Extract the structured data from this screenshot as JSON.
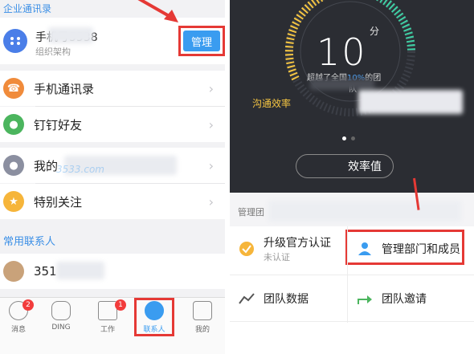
{
  "left": {
    "section_enterprise": "企业通讯录",
    "org": {
      "name": "手机号5538",
      "subtitle": "组织架构"
    },
    "manage_button": "管理",
    "rows": [
      {
        "label": "手机通讯录",
        "icon": "phone-contacts-icon",
        "color": "#f08b3b"
      },
      {
        "label": "钉钉好友",
        "icon": "friend-icon",
        "color": "#4bb55e"
      },
      {
        "label": "我的",
        "icon": "my-icon",
        "color": "#8b8fa0"
      },
      {
        "label": "特别关注",
        "icon": "star-icon",
        "color": "#f6b53a"
      }
    ],
    "section_frequent": "常用联系人",
    "frequent_contact": "351",
    "tabs": [
      {
        "label": "消息",
        "badge": "2",
        "icon": "message-icon"
      },
      {
        "label": "DING",
        "badge": "",
        "icon": "ding-icon"
      },
      {
        "label": "工作",
        "badge": "1",
        "icon": "work-icon"
      },
      {
        "label": "联系人",
        "badge": "",
        "icon": "contacts-icon"
      },
      {
        "label": "我的",
        "badge": "",
        "icon": "profile-icon"
      }
    ],
    "watermark": "3533.com"
  },
  "right": {
    "score": "10",
    "score_unit": "分",
    "exceed_prefix": "超越了全国",
    "exceed_pct": "10%",
    "exceed_suffix": "的团",
    "exceed_tail": "队",
    "efficiency_label": "沟通效率",
    "pill_text": "效率值",
    "mgmt_title": "管理团",
    "cells": {
      "upgrade": {
        "label": "升级官方认证",
        "sub": "未认证"
      },
      "manage_dept": {
        "label": "管理部门和成员"
      },
      "team_data": {
        "label": "团队数据"
      },
      "team_invite": {
        "label": "团队邀请"
      }
    }
  },
  "colors": {
    "accent": "#3a9cf0",
    "highlight": "#e53935",
    "dark_bg": "#2b2d33"
  }
}
